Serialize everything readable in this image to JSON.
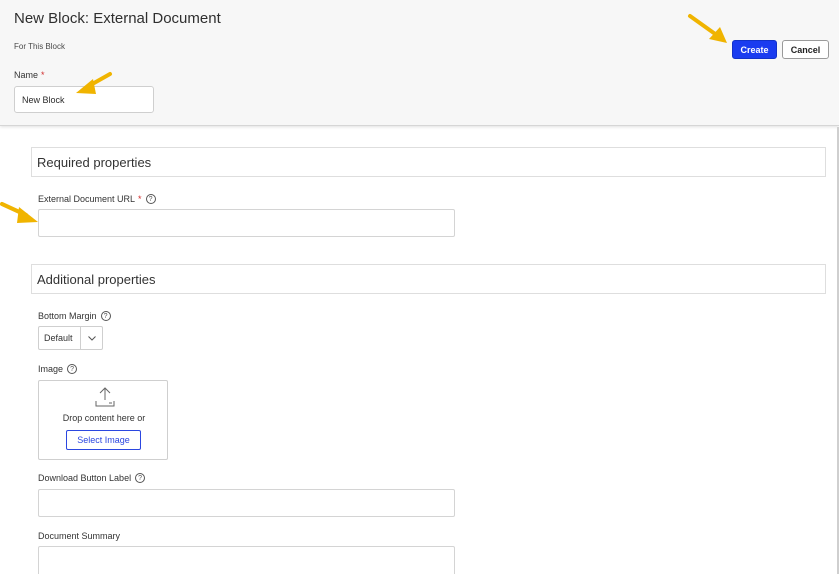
{
  "header": {
    "title": "New Block: External Document",
    "subtitle": "For This Block",
    "name_label": "Name",
    "required_mark": "*",
    "name_value": "New Block",
    "create_label": "Create",
    "cancel_label": "Cancel"
  },
  "required_section": {
    "title": "Required properties",
    "url_label": "External Document URL",
    "url_value": ""
  },
  "additional_section": {
    "title": "Additional properties",
    "bottom_margin_label": "Bottom Margin",
    "bottom_margin_value": "Default",
    "image_label": "Image",
    "drop_text": "Drop content here or",
    "select_image_label": "Select Image",
    "download_label": "Download Button Label",
    "download_value": "",
    "summary_label": "Document Summary",
    "summary_value": ""
  },
  "icons": {
    "help": "?",
    "annotation_arrow": "arrow-icon",
    "upload": "upload-icon",
    "chevron": "chevron-down-icon"
  },
  "colors": {
    "accent": "#1a3cf0",
    "required": "#d12c2c",
    "annotation": "#f0b400"
  }
}
